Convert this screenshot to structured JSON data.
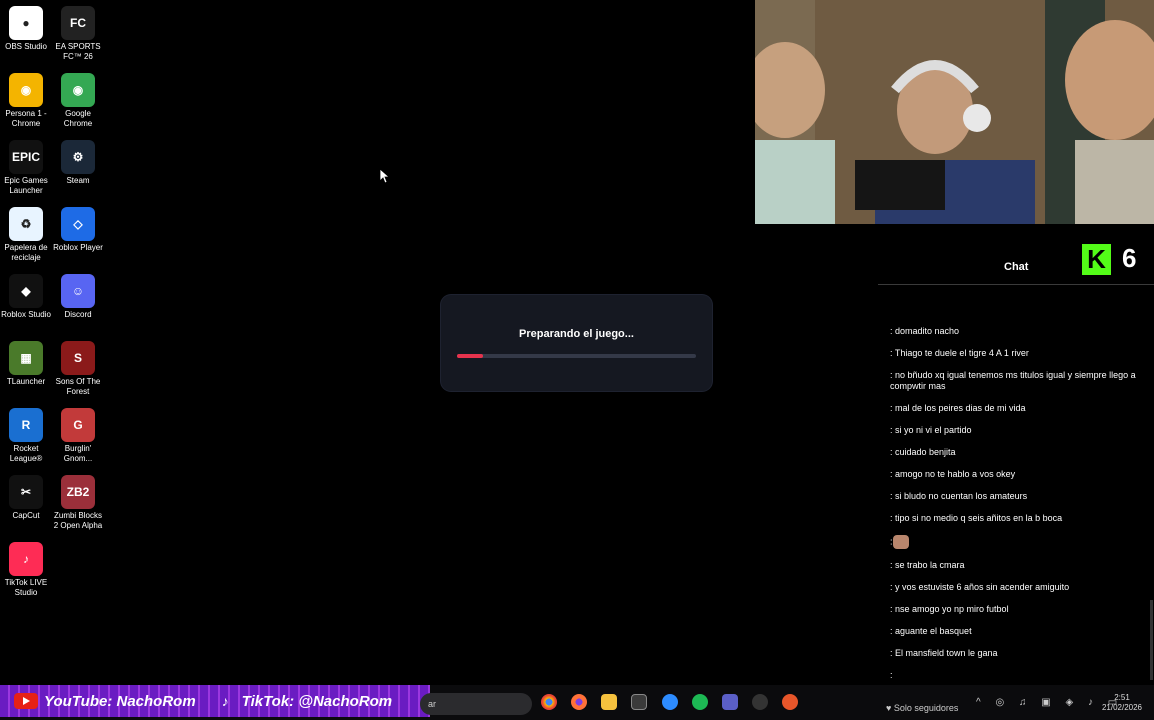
{
  "desktop_icons": [
    {
      "label": "OBS Studio",
      "glyph": "●",
      "color": "#ffffff",
      "icon": "obs-icon"
    },
    {
      "label": "EA SPORTS FC™ 26",
      "glyph": "FC",
      "color": "#222222",
      "icon": "ea-fc-icon"
    },
    {
      "label": "Persona 1 - Chrome",
      "glyph": "◉",
      "color": "#f4b400",
      "icon": "chrome-profile-icon"
    },
    {
      "label": "Google Chrome",
      "glyph": "◉",
      "color": "#34a853",
      "icon": "chrome-icon"
    },
    {
      "label": "Epic Games Launcher",
      "glyph": "EPIC",
      "color": "#111111",
      "icon": "epic-games-icon"
    },
    {
      "label": "Steam",
      "glyph": "⚙",
      "color": "#1b2838",
      "icon": "steam-icon"
    },
    {
      "label": "Papelera de reciclaje",
      "glyph": "♻",
      "color": "#e8f4ff",
      "icon": "recycle-bin-icon"
    },
    {
      "label": "Roblox Player",
      "glyph": "◇",
      "color": "#1e6be6",
      "icon": "roblox-player-icon"
    },
    {
      "label": "Roblox Studio",
      "glyph": "◆",
      "color": "#111111",
      "icon": "roblox-studio-icon"
    },
    {
      "label": "Discord",
      "glyph": "☺",
      "color": "#5865f2",
      "icon": "discord-icon"
    },
    {
      "label": "TLauncher",
      "glyph": "▦",
      "color": "#4a7a2a",
      "icon": "tlauncher-icon"
    },
    {
      "label": "Sons Of The Forest",
      "glyph": "S",
      "color": "#8b1a1a",
      "icon": "sons-of-the-forest-icon"
    },
    {
      "label": "Rocket League®",
      "glyph": "R",
      "color": "#1a6fd1",
      "icon": "rocket-league-icon"
    },
    {
      "label": "Burglin' Gnom...",
      "glyph": "G",
      "color": "#c23a3a",
      "icon": "burglin-gnomes-icon"
    },
    {
      "label": "CapCut",
      "glyph": "✂",
      "color": "#111111",
      "icon": "capcut-icon"
    },
    {
      "label": "Zumbi Blocks 2 Open Alpha",
      "glyph": "ZB2",
      "color": "#9b2f3a",
      "icon": "zumbi-blocks-icon"
    },
    {
      "label": "TikTok LIVE Studio",
      "glyph": "♪",
      "color": "#fe2c55",
      "icon": "tiktok-live-studio-icon"
    }
  ],
  "dialog": {
    "title": "Preparando el juego...",
    "progress": 0.11
  },
  "chat": {
    "title": "Chat",
    "viewers": "6",
    "messages": [
      ": domadito nacho",
      ": Thiago te duele el tigre 4 A 1 river",
      ": no bñudo xq igual tenemos ms titulos igual y siempre llego a compwtir mas",
      ": mal de los peires dias de mi vida",
      ": si yo ni vi el partido",
      ": cuidado benjita",
      ": amogo no te hablo a vos okey",
      ": si bludo no cuentan los amateurs",
      ": tipo si no medio q seis añitos en la b boca",
      ":",
      ": se trabo la cmara",
      ": y vos estuviste 6 años sin acender amiguito",
      ": nse amogo yo np miro futbol",
      ": aguante el basquet",
      ": El mansfield town le gana",
      ":"
    ]
  },
  "banner": {
    "youtube": "YouTube: NachoRom",
    "tiktok": "TikTok: @NachoRom"
  },
  "taskbar": {
    "search_text": "ar",
    "solo_seguidores": "♥ Solo seguidores",
    "time": "2:51",
    "date": "21/02/2026"
  }
}
